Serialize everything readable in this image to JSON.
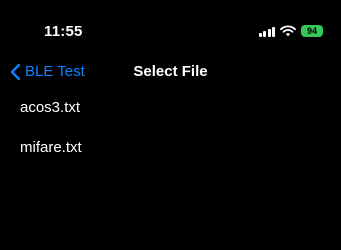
{
  "status_bar": {
    "time": "11:55",
    "battery": "94",
    "battery_color": "#34c759",
    "icons": [
      "signal-icon",
      "wifi-icon",
      "battery-icon"
    ]
  },
  "nav": {
    "back_label": "BLE Test",
    "back_icon": "chevron-left-icon",
    "title": "Select File",
    "accent_color": "#0a84ff"
  },
  "files": [
    {
      "name": "acos3.txt"
    },
    {
      "name": "mifare.txt"
    }
  ]
}
